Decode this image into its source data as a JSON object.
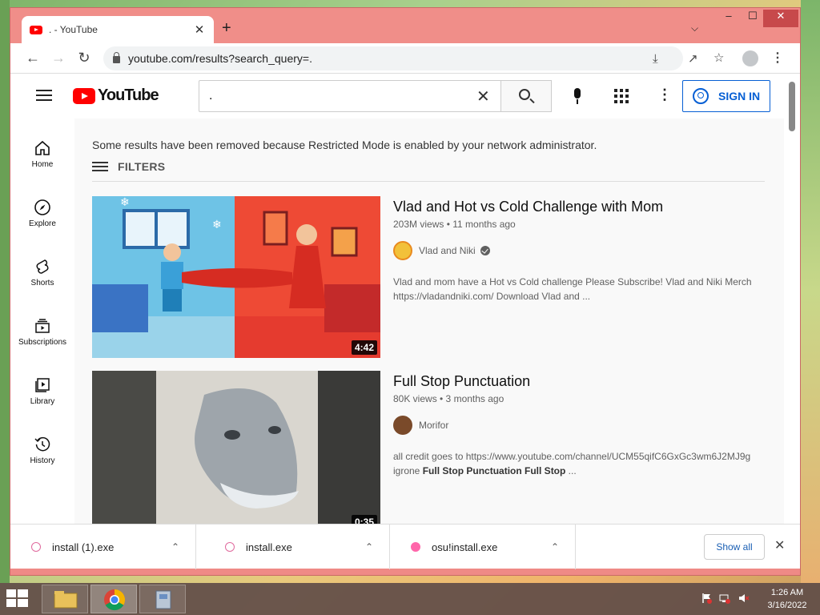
{
  "browser": {
    "tab_title": ". - YouTube",
    "new_tab": "+",
    "tab_close": "✕",
    "url": "youtube.com/results?search_query=.",
    "window_controls": {
      "minimize": "‒",
      "maximize": "☐",
      "close": "✕"
    }
  },
  "youtube": {
    "logo_text": "YouTube",
    "search_value": ".",
    "signin_label": "SIGN IN",
    "sidebar": [
      {
        "label": "Home",
        "icon": "home-icon"
      },
      {
        "label": "Explore",
        "icon": "compass-icon"
      },
      {
        "label": "Shorts",
        "icon": "shorts-icon"
      },
      {
        "label": "Subscriptions",
        "icon": "subscriptions-icon"
      },
      {
        "label": "Library",
        "icon": "library-icon"
      },
      {
        "label": "History",
        "icon": "history-icon"
      }
    ],
    "notice": "Some results have been removed because Restricted Mode is enabled by your network administrator.",
    "filters_label": "FILTERS",
    "videos": [
      {
        "title": "Vlad and Hot vs Cold Challenge with Mom",
        "meta": "203M views • 11 months ago",
        "channel": "Vlad and Niki",
        "verified": true,
        "description": "Vlad and mom have a Hot vs Cold challenge Please Subscribe! Vlad and Niki Merch https://vladandniki.com/ Download Vlad and ...",
        "duration": "4:42"
      },
      {
        "title": "Full Stop Punctuation",
        "meta": "80K views • 3 months ago",
        "channel": "Morifor",
        "verified": false,
        "description_plain": "all credit goes to https://www.youtube.com/channel/UCM55qifC6GxGc3wm6J2MJ9g igrone ",
        "description_bold": "Full Stop Punctuation Full Stop",
        "description_tail": " ...",
        "duration": "0:35"
      }
    ]
  },
  "downloads": {
    "items": [
      "install (1).exe",
      "install.exe",
      "osu!install.exe"
    ],
    "show_all": "Show all",
    "close": "✕"
  },
  "taskbar": {
    "time": "1:26 AM",
    "date": "3/16/2022"
  },
  "colors": {
    "window_frame": "#ef8a86",
    "yt_red": "#ff0000",
    "signin_blue": "#065fd4"
  }
}
